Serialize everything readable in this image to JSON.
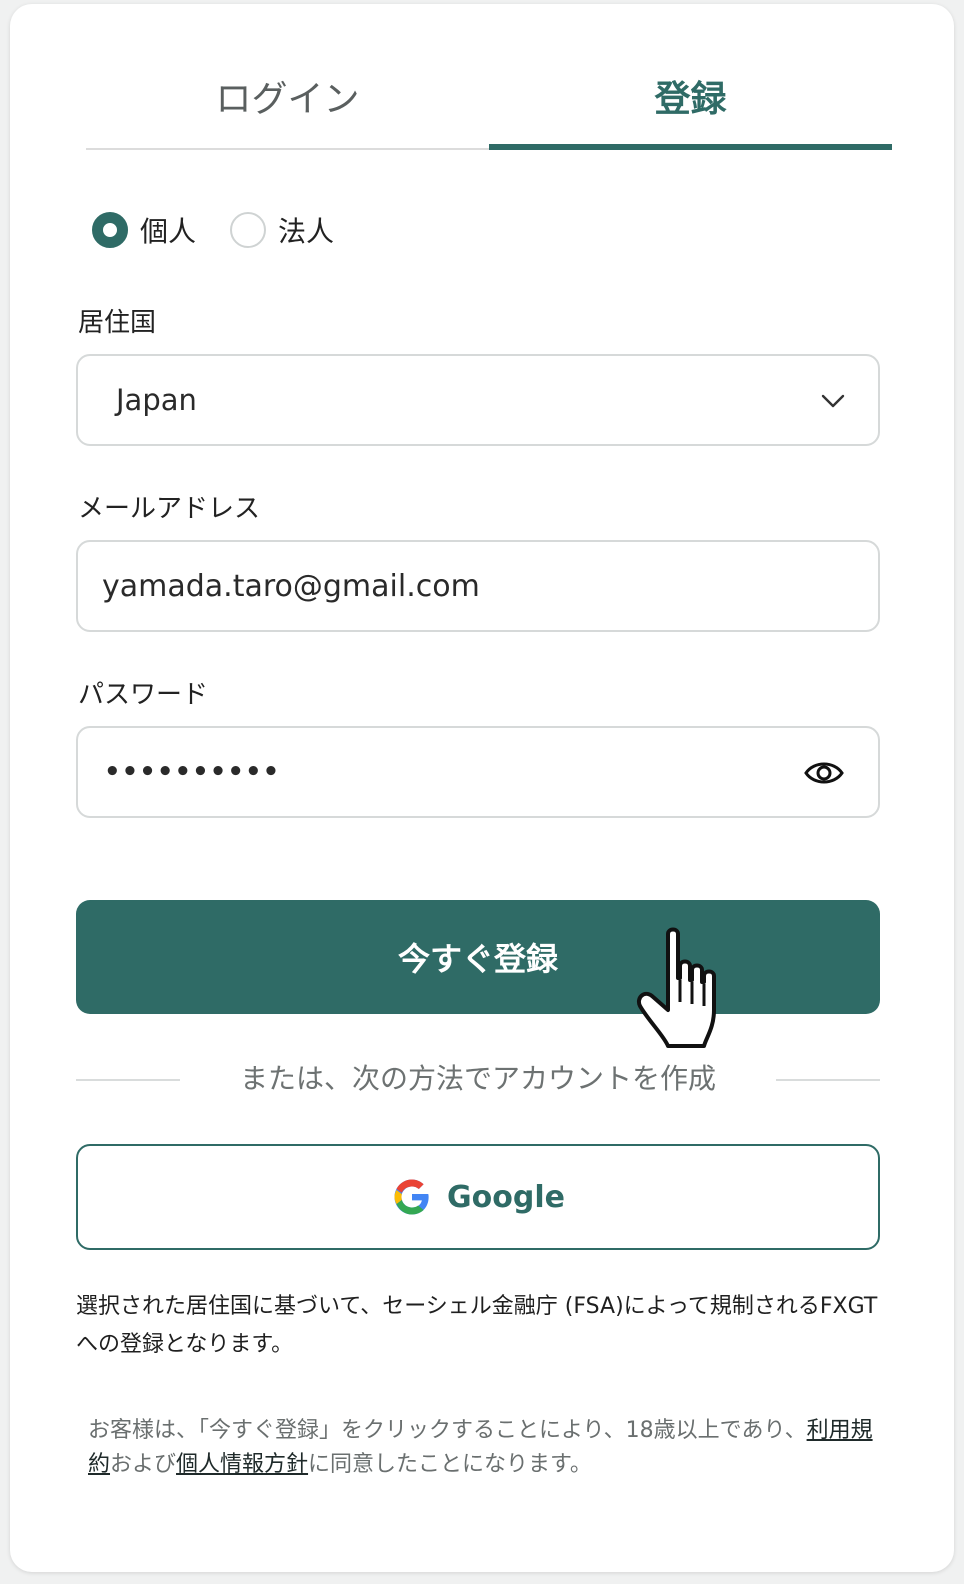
{
  "tabs": {
    "login": "ログイン",
    "register": "登録",
    "active": "register"
  },
  "account_type": {
    "options": [
      "個人",
      "法人"
    ],
    "selected": "個人"
  },
  "residence": {
    "label": "居住国",
    "value": "Japan"
  },
  "email": {
    "label": "メールアドレス",
    "value": "yamada.taro@gmail.com"
  },
  "password": {
    "label": "パスワード",
    "masked_value": "••••••••••"
  },
  "submit": {
    "label": "今すぐ登録"
  },
  "divider": {
    "text": "または、次の方法でアカウントを作成"
  },
  "google": {
    "label": "Google"
  },
  "notice": {
    "text": "選択された居住国に基づいて、セーシェル金融庁 (FSA)によって規制されるFXGTへの登録となります。"
  },
  "terms": {
    "prefix": "お客様は、「今すぐ登録」をクリックすることにより、18歳以上であり、",
    "link_terms": "利用規約",
    "middle": "および",
    "link_privacy": "個人情報方針",
    "suffix": "に同意したことになります。"
  },
  "colors": {
    "brand": "#2f6b66",
    "field_border": "#d6d9d9",
    "muted_text": "#6d7272"
  },
  "icons": [
    "chevron-down-icon",
    "eye-icon",
    "google-g-icon",
    "hand-pointer-icon"
  ]
}
